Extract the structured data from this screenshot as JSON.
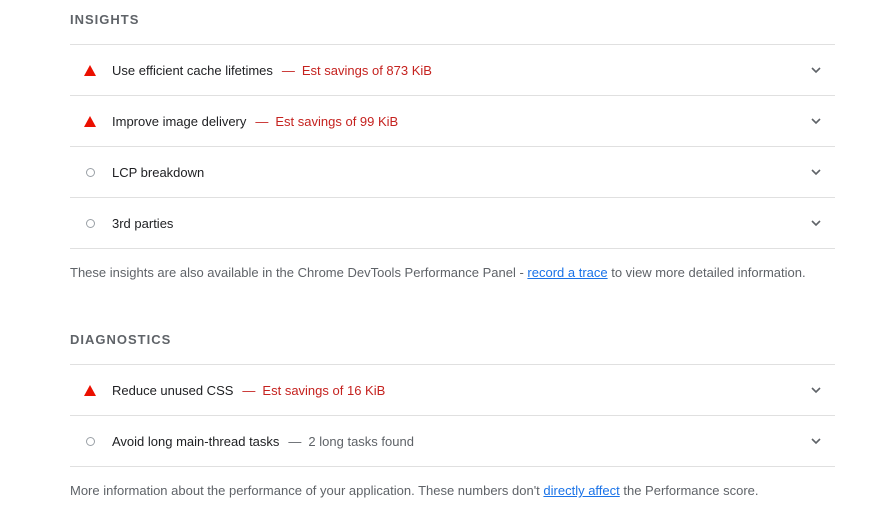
{
  "insights": {
    "title": "INSIGHTS",
    "items": [
      {
        "status": "fail",
        "title": "Use efficient cache lifetimes",
        "separator": "—",
        "detail": "Est savings of 873 KiB"
      },
      {
        "status": "fail",
        "title": "Improve image delivery",
        "separator": "—",
        "detail": "Est savings of 99 KiB"
      },
      {
        "status": "info",
        "title": "LCP breakdown"
      },
      {
        "status": "info",
        "title": "3rd parties"
      }
    ],
    "note": {
      "before": "These insights are also available in the Chrome DevTools Performance Panel - ",
      "link": "record a trace",
      "after": " to view more detailed information."
    }
  },
  "diagnostics": {
    "title": "DIAGNOSTICS",
    "items": [
      {
        "status": "fail",
        "title": "Reduce unused CSS",
        "separator": "—",
        "detail": "Est savings of 16 KiB"
      },
      {
        "status": "info",
        "title": "Avoid long main-thread tasks",
        "separator": "—",
        "detail": "2 long tasks found"
      }
    ],
    "note": {
      "before": "More information about the performance of your application. These numbers don't ",
      "link": "directly affect",
      "after": " the Performance score."
    }
  },
  "colors": {
    "fail": "#eb0f00",
    "fail_text": "#c5221f",
    "muted_text": "#5f6368",
    "link": "#1a73e8",
    "divider": "#e0e0e0"
  },
  "icons": {
    "fail": "warning-triangle-icon",
    "info": "empty-circle-icon",
    "expand": "chevron-down-icon"
  }
}
